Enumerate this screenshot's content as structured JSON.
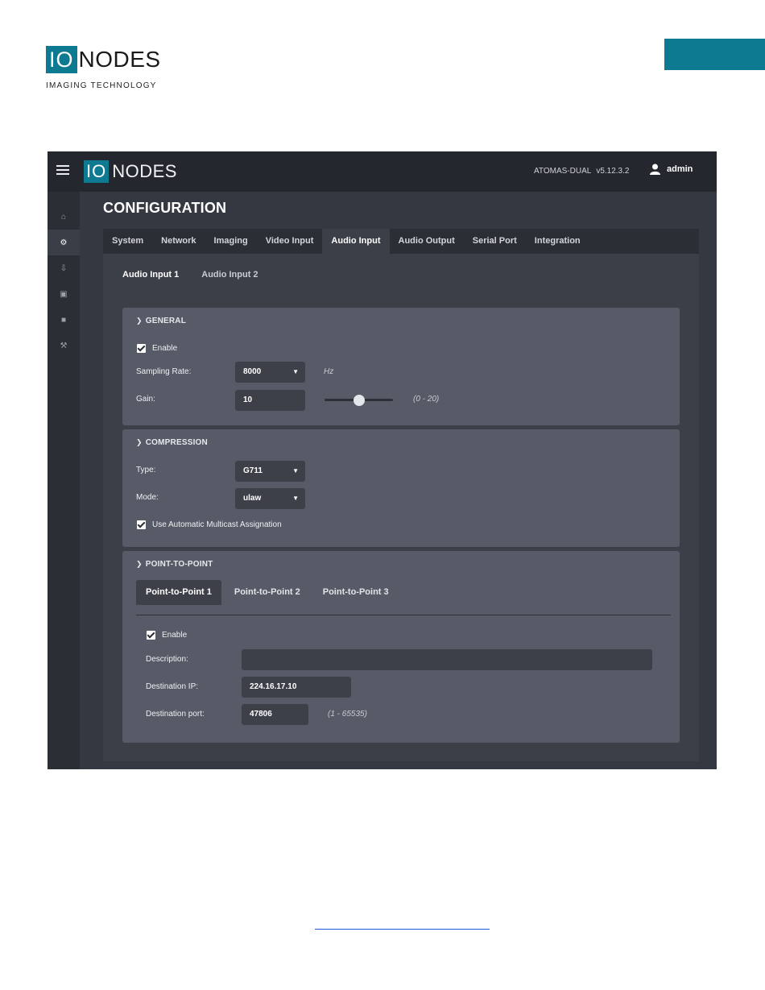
{
  "document": {
    "logo_io": "IO",
    "logo_nodes": "NODES",
    "tagline": "IMAGING TECHNOLOGY"
  },
  "app": {
    "logo_io": "IO",
    "logo_nodes": "NODES",
    "device_name": "ATOMAS-DUAL",
    "version": "v5.12.3.2",
    "user": "admin",
    "page_title": "CONFIGURATION"
  },
  "sidebar": {
    "items": [
      {
        "icon": "home-icon",
        "glyph": "⌂"
      },
      {
        "icon": "gear-icon",
        "glyph": "⚙",
        "active": true
      },
      {
        "icon": "usb-icon",
        "glyph": "⇩"
      },
      {
        "icon": "camera-icon",
        "glyph": "▣"
      },
      {
        "icon": "lock-icon",
        "glyph": "■"
      },
      {
        "icon": "wrench-icon",
        "glyph": "⚒"
      }
    ]
  },
  "tabs": [
    "System",
    "Network",
    "Imaging",
    "Video Input",
    "Audio Input",
    "Audio Output",
    "Serial Port",
    "Integration"
  ],
  "active_tab": "Audio Input",
  "subtabs": [
    "Audio Input 1",
    "Audio Input 2"
  ],
  "general": {
    "title": "GENERAL",
    "enable_label": "Enable",
    "sampling_rate_label": "Sampling Rate:",
    "sampling_rate_value": "8000",
    "sampling_rate_unit": "Hz",
    "gain_label": "Gain:",
    "gain_value": "10",
    "gain_range": "(0 - 20)",
    "gain_slider_fraction": 0.5
  },
  "compression": {
    "title": "COMPRESSION",
    "type_label": "Type:",
    "type_value": "G711",
    "mode_label": "Mode:",
    "mode_value": "ulaw",
    "multicast_label": "Use Automatic Multicast Assignation"
  },
  "p2p": {
    "title": "POINT-TO-POINT",
    "tabs": [
      "Point-to-Point 1",
      "Point-to-Point 2",
      "Point-to-Point 3"
    ],
    "enable_label": "Enable",
    "description_label": "Description:",
    "description_value": "",
    "dest_ip_label": "Destination IP:",
    "dest_ip_value": "224.16.17.10",
    "dest_port_label": "Destination port:",
    "dest_port_value": "47806",
    "port_range": "(1 - 65535)"
  },
  "colors": {
    "brand_teal": "#0e7a92",
    "panel": "#575b67",
    "field": "#3d4049"
  }
}
